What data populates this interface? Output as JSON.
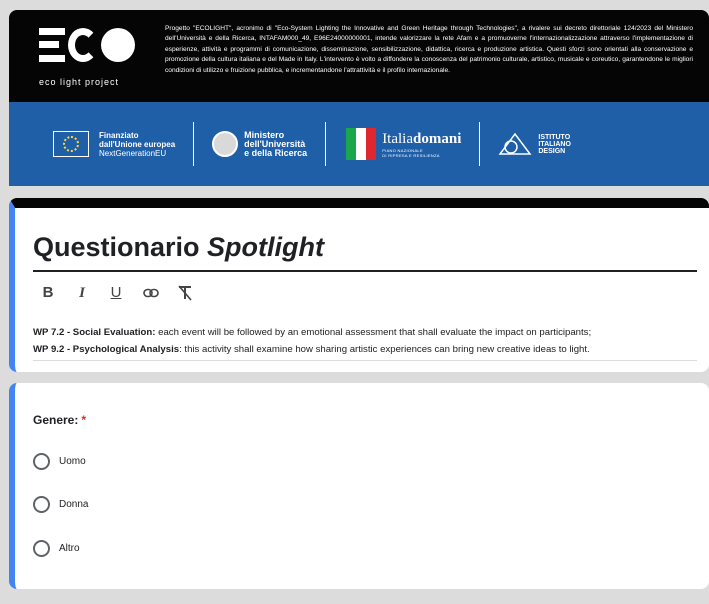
{
  "header": {
    "logo_text": "eco light project",
    "description": "Progetto \"ECOLIGHT\", acronimo di \"Eco-System Lighting the Innovative and Green Heritage through Technologies\", a rivalere sui decreto direttoriale 124/2023 del Ministero dell'Università e della Ricerca, INTAFAM000_49, E96E24000000001, intende valorizzare la rete Afam e a promuoverne l'internazionalizzazione attraverso l'implementazione di esperienze, attività e programmi di comunicazione, disseminazione, sensibilizzazione, didattica, ricerca e produzione artistica. Questi sforzi sono orientati alla conservazione e promozione della cultura italiana e del Made in Italy. L'intervento è volto a diffondere la conoscenza del patrimonio culturale, artistico, musicale e coreutico, garantendone le migliori condizioni di utilizzo e fruizione pubblica, e incrementandone l'attrattività e il profilo internazionale.",
    "partners": {
      "eu_line1": "Finanziato",
      "eu_line2": "dall'Unione europea",
      "eu_line3": "NextGenerationEU",
      "min_line1": "Ministero",
      "min_line2": "dell'Università",
      "min_line3": "e della Ricerca",
      "italia_prefix": "Italia",
      "italia_suffix": "domani",
      "italia_sub1": "PIANO NAZIONALE",
      "italia_sub2": "DI RIPRESA E RESILIENZA",
      "iid_line1": "ISTITUTO",
      "iid_line2": "ITALIANO",
      "iid_line3": "DESIGN"
    }
  },
  "form": {
    "title_main": "Questionario ",
    "title_italic": "Spotlight",
    "toolbar": [
      "B",
      "I",
      "U",
      "⊖",
      "T̸"
    ],
    "desc1_bold": "WP 7.2 - Social Evaluation:",
    "desc1_text": " each event will be followed by an emotional assessment that shall evaluate the impact on participants;",
    "desc2_bold": "WP 9.2 - Psychological Analysis",
    "desc2_text": ": this activity shall examine how sharing artistic experiences can bring new creative ideas to light."
  },
  "question": {
    "title": "Genere:",
    "required_mark": "*",
    "options": [
      "Uomo",
      "Donna",
      "Altro"
    ]
  },
  "colors": {
    "accent": "#4285f4",
    "banner_blue": "#1f5fa8",
    "required": "#d93025"
  }
}
